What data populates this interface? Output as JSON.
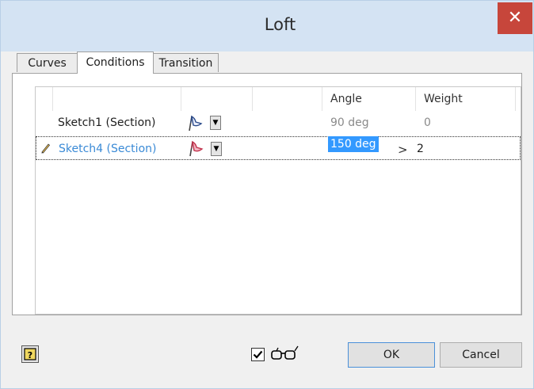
{
  "window": {
    "title": "Loft",
    "close_glyph": "✕"
  },
  "tabs": [
    {
      "label": "Curves",
      "active": false
    },
    {
      "label": "Conditions",
      "active": true
    },
    {
      "label": "Transition",
      "active": false
    }
  ],
  "grid": {
    "columns": {
      "angle": "Angle",
      "weight": "Weight"
    },
    "rows": [
      {
        "name": "Sketch1 (Section)",
        "angle": "90 deg",
        "weight": "0",
        "editing": false
      },
      {
        "name": "Sketch4 (Section)",
        "angle": "150 deg",
        "weight": "2",
        "editing": true,
        "expand_glyph": ">"
      }
    ],
    "icons": {
      "condition": "flag-icon",
      "edit": "pencil-icon"
    }
  },
  "footer": {
    "ok_label": "OK",
    "cancel_label": "Cancel",
    "preview_checked": true,
    "icons": {
      "help": "help-icon",
      "preview": "glasses-icon"
    }
  },
  "colors": {
    "selection": "#3399ff",
    "edit_text": "#3a8ad6",
    "close": "#c7463b",
    "titlebar": "#d4e3f3"
  }
}
